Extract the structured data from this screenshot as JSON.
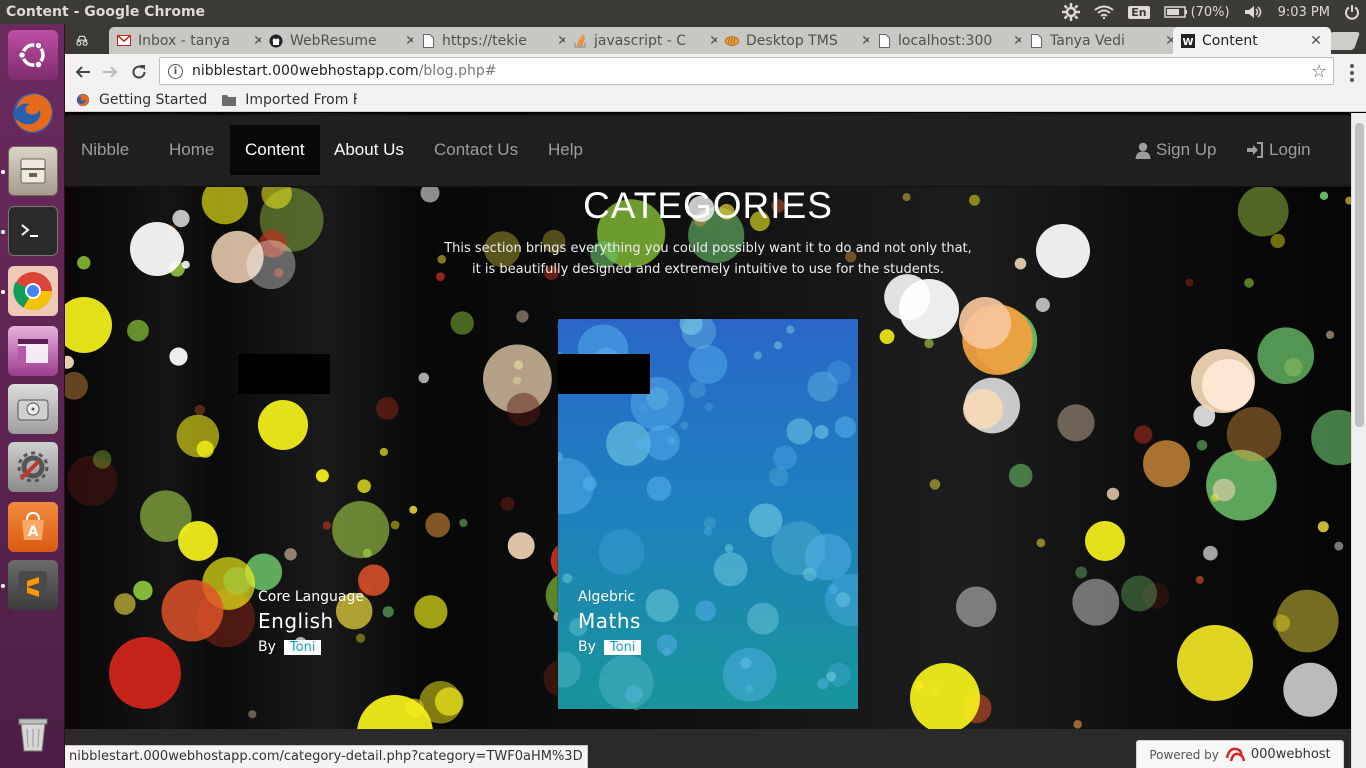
{
  "os": {
    "window_title": "Content - Google Chrome",
    "lang": "En",
    "battery": "(70%)",
    "clock": "9:03 PM"
  },
  "launcher": {
    "items": [
      "ubuntu-dash-icon",
      "firefox-icon",
      "files-icon",
      "terminal-icon",
      "chrome-icon",
      "workspace-icon",
      "disk-icon",
      "settings-icon",
      "software-center-icon",
      "sublime-text-icon",
      "trash-icon"
    ]
  },
  "tabs": [
    {
      "label": "",
      "icon": "incognito-icon"
    },
    {
      "label": "Inbox - tanya",
      "icon": "gmail-icon"
    },
    {
      "label": "WebResume",
      "icon": "github-icon"
    },
    {
      "label": "https://tekie",
      "icon": "page-icon"
    },
    {
      "label": "javascript - C",
      "icon": "stackoverflow-icon"
    },
    {
      "label": "Desktop TMS",
      "icon": "bread-icon"
    },
    {
      "label": "localhost:300",
      "icon": "page-icon"
    },
    {
      "label": "Tanya Vedi",
      "icon": "page-icon"
    },
    {
      "label": "Content",
      "icon": "w-icon"
    }
  ],
  "toolbar": {
    "url_host": "nibblestart.000webhostapp.com",
    "url_path": "/blog.php#"
  },
  "bookmarks": [
    {
      "label": "Getting Started",
      "icon": "firefox-icon"
    },
    {
      "label": "Imported From F",
      "icon": "folder-icon"
    }
  ],
  "site": {
    "brand": "Nibble",
    "nav": [
      "Home",
      "Content",
      "About Us",
      "Contact Us",
      "Help"
    ],
    "signup": "Sign Up",
    "login": "Login",
    "hero_title": "CATEGORIES",
    "hero_line1": "This section brings everything you could possibly want it to do and not only that,",
    "hero_line2": "it is beautifully designed and extremely intuitive to use for the students.",
    "cards": [
      {
        "sub": "Core Language",
        "title": "English",
        "by": "By",
        "author": "Toni"
      },
      {
        "sub": "Algebric",
        "title": "Maths",
        "by": "By",
        "author": "Toni"
      }
    ]
  },
  "status": {
    "link": "nibblestart.000webhostapp.com/category-detail.php?category=TWF0aHM%3D"
  },
  "powered": {
    "prefix": "Powered by",
    "brand": "000webhost"
  },
  "colors": {
    "launcher": "#5e2453",
    "navbar": "#1f1f1f",
    "card_gradient_top": "#2a66c9",
    "card_gradient_bottom": "#17959a",
    "author_badge_text": "#17a2c8"
  }
}
